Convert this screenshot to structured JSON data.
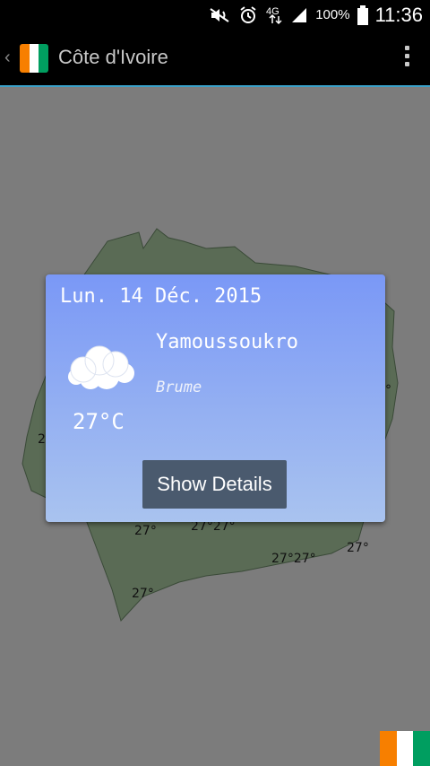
{
  "status_bar": {
    "battery_percent": "100%",
    "time": "11:36",
    "network_label": "4G",
    "icons": [
      "mute-icon",
      "alarm-icon",
      "4g-icon",
      "signal-icon",
      "battery-icon"
    ]
  },
  "action_bar": {
    "title": "Côte d'Ivoire",
    "icons": [
      "back-chevron-icon",
      "flag-icon",
      "overflow-menu-icon"
    ]
  },
  "map": {
    "temperatures": [
      "27°",
      "27°27°",
      "27°",
      "27°27°",
      "27°",
      "2",
      "°"
    ]
  },
  "dialog": {
    "date": "Lun. 14 Déc. 2015",
    "city": "Yamoussoukro",
    "condition": "Brume",
    "temperature": "27°C",
    "button_label": "Show Details",
    "weather_icon": "cloud-icon"
  },
  "colors": {
    "dialog_gradient_top": "#7a98f6",
    "dialog_gradient_bottom": "#a9c3ef",
    "button_bg": "#4a5a6e",
    "map_bg": "#7c7c7c",
    "land": "#5a6b55",
    "accent_line": "#3aa0c8"
  }
}
